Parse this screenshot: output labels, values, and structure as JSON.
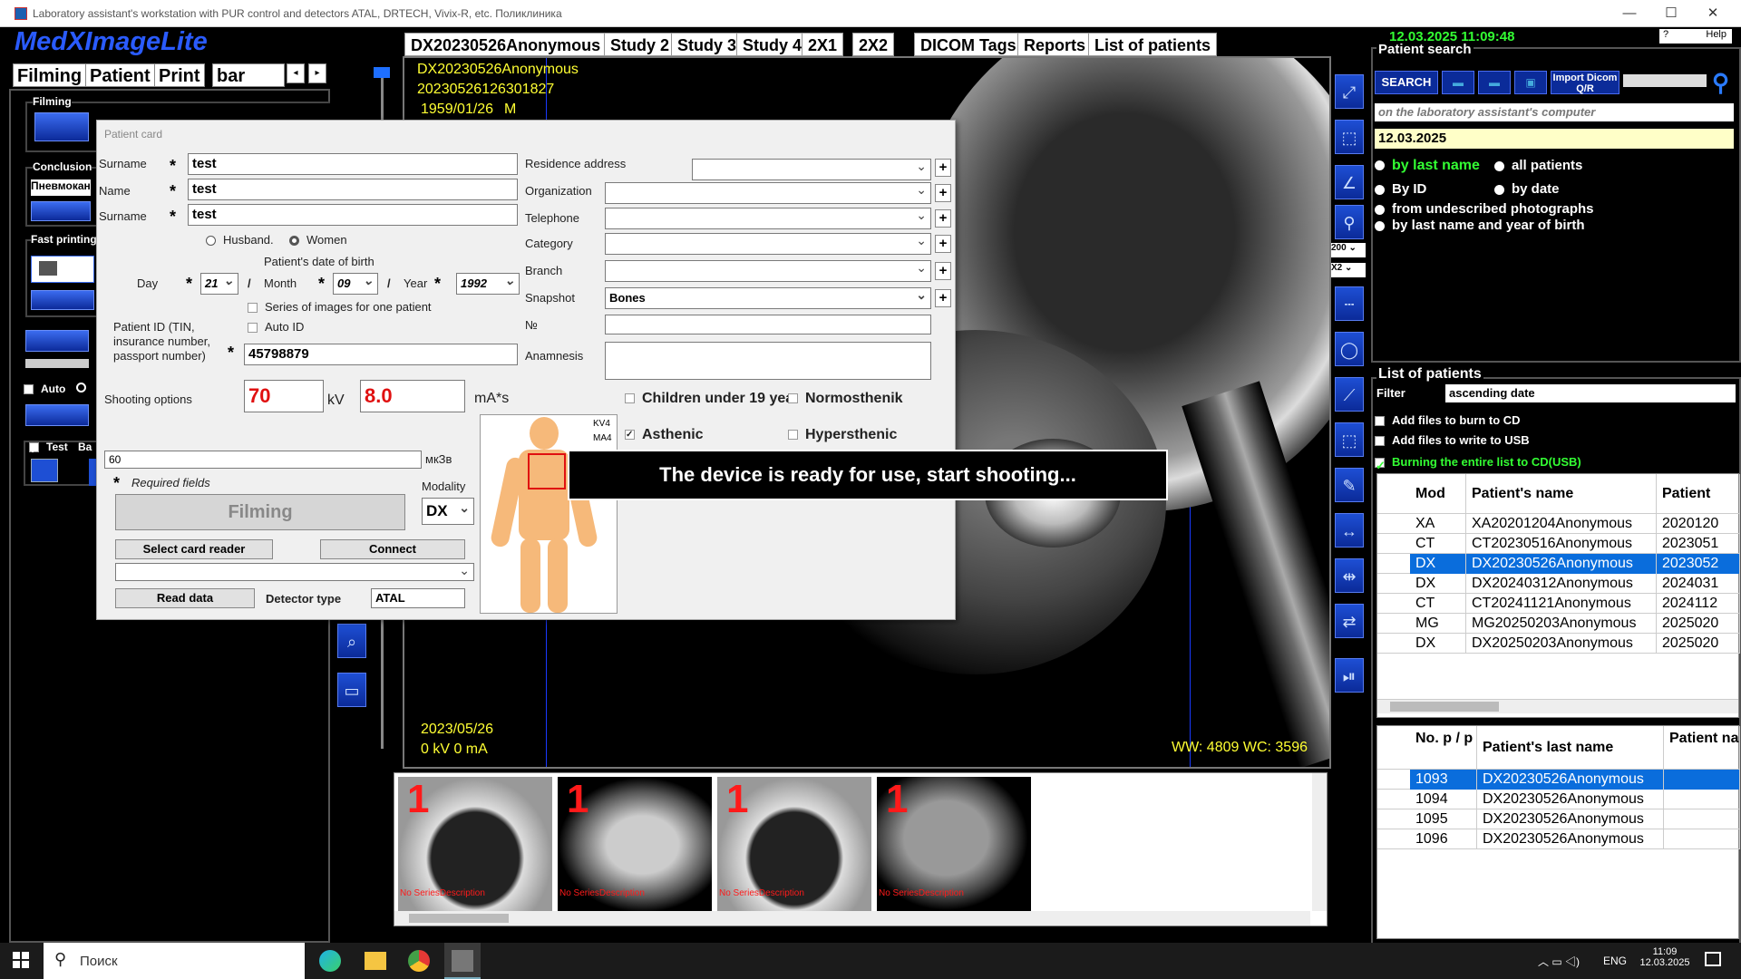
{
  "window": {
    "title": "Laboratory assistant's workstation with PUR control and detectors ATAL, DRTECH, Vivix-R, etc. Поликлиника",
    "minimize": "—",
    "maximize": "☐",
    "close": "✕"
  },
  "app": {
    "logo": "MedXImageLite",
    "datetime": "12.03.2025 11:09:48",
    "help": "Help"
  },
  "left_tabs": [
    "Filming",
    "Patient",
    "Print",
    "bar char"
  ],
  "left_panel": {
    "filming_label": "Filming",
    "conclusion_label": "Conclusion",
    "conclusion_value": "Пневмокани",
    "fast_printing_label": "Fast printing",
    "auto_label": "Auto",
    "test_label": "Test",
    "ba_label": "Ba"
  },
  "top_tabs": [
    "DX20230526Anonymous |",
    "Study 2",
    "Study 3",
    "Study 4",
    "2X1",
    "2X2",
    "DICOM Tags",
    "Reports",
    "List of patients"
  ],
  "viewer": {
    "patient": "DX20230526Anonymous",
    "study_id": "20230526126301827",
    "dob": "1959/01/26",
    "sex": "M",
    "study_date": "2023/05/26",
    "exposure": "0 kV  0 mA",
    "window_level": "WW: 4809  WC: 3596"
  },
  "tool_zoom": "200",
  "tool_x2": "X2",
  "patient_search": {
    "title": "Patient search",
    "search_btn": "SEARCH",
    "import_btn": "Import Dicom Q/R",
    "location": "on the laboratory assistant's computer",
    "date": "12.03.2025",
    "options": [
      "by last name",
      "all patients",
      "By ID",
      "by date",
      "from undescribed photographs",
      "by last name and year of birth"
    ]
  },
  "patients_list": {
    "title": "List of patients",
    "filter_label": "Filter",
    "filter_value": "ascending date",
    "burn_cd": "Add files to burn to CD",
    "write_usb": "Add files to write to USB",
    "burn_all": "Burning the entire list to CD(USB)",
    "columns": [
      "Mod",
      "Patient's name",
      "Patient"
    ],
    "rows": [
      [
        "XA",
        "XA20201204Anonymous",
        "2020120"
      ],
      [
        "CT",
        "CT20230516Anonymous",
        "2023051"
      ],
      [
        "DX",
        "DX20230526Anonymous",
        "2023052"
      ],
      [
        "DX",
        "DX20240312Anonymous",
        "2024031"
      ],
      [
        "CT",
        "CT20241121Anonymous",
        "2024112"
      ],
      [
        "MG",
        "MG20250203Anonymous",
        "2025020"
      ],
      [
        "DX",
        "DX20250203Anonymous",
        "2025020"
      ]
    ]
  },
  "studies_list": {
    "columns": [
      "No. p / p",
      "Patient's last name",
      "Patient name"
    ],
    "rows": [
      [
        "1093",
        "DX20230526Anonymous",
        ""
      ],
      [
        "1094",
        "DX20230526Anonymous",
        ""
      ],
      [
        "1095",
        "DX20230526Anonymous",
        ""
      ],
      [
        "1096",
        "DX20230526Anonymous",
        ""
      ]
    ]
  },
  "dialog": {
    "caption": "Patient card",
    "surname_label": "Surname",
    "surname": "test",
    "name_label": "Name",
    "name": "test",
    "patronymic_label": "Surname",
    "patronymic": "test",
    "husband": "Husband.",
    "women": "Women",
    "dob_title": "Patient's date of birth",
    "day_label": "Day",
    "day": "21",
    "month_label": "Month",
    "month": "09",
    "year_label": "Year",
    "year": "1992",
    "series_label": "Series of images for one patient",
    "auto_id_label": "Auto ID",
    "pid_label": "Patient ID (TIN, insurance number, passport number)",
    "pid": "45798879",
    "residence_label": "Residence address",
    "organization_label": "Organization",
    "telephone_label": "Telephone",
    "category_label": "Category",
    "branch_label": "Branch",
    "snapshot_label": "Snapshot",
    "snapshot": "Bones",
    "no_label": "№",
    "anamnesis_label": "Anamnesis",
    "shooting_label": "Shooting options",
    "kv": "70",
    "kv_unit": "kV",
    "mas": "8.0",
    "mas_unit": "mA*s",
    "children": "Children under 19 yea",
    "normo": "Normosthenik",
    "asthenic": "Asthenic",
    "hyper": "Hypersthenic",
    "dose": "60",
    "dose_unit": "мкЗв",
    "required": "Required fields",
    "modality_label": "Modality",
    "modality": "DX",
    "filming_btn": "Filming",
    "select_reader": "Select card reader",
    "connect": "Connect",
    "read_data": "Read data",
    "detector_label": "Detector type",
    "detector": "ATAL",
    "kv4": "KV4",
    "ma4": "MA4"
  },
  "ready_msg": "The device is ready for use, start shooting...",
  "thumbs": [
    {
      "n": "1",
      "d": "No SeriesDescription"
    },
    {
      "n": "1",
      "d": "No SeriesDescription"
    },
    {
      "n": "1",
      "d": "No SeriesDescription"
    },
    {
      "n": "1",
      "d": "No SeriesDescription"
    }
  ],
  "taskbar": {
    "search": "Поиск",
    "lang": "ENG",
    "time": "11:09",
    "date": "12.03.2025"
  }
}
